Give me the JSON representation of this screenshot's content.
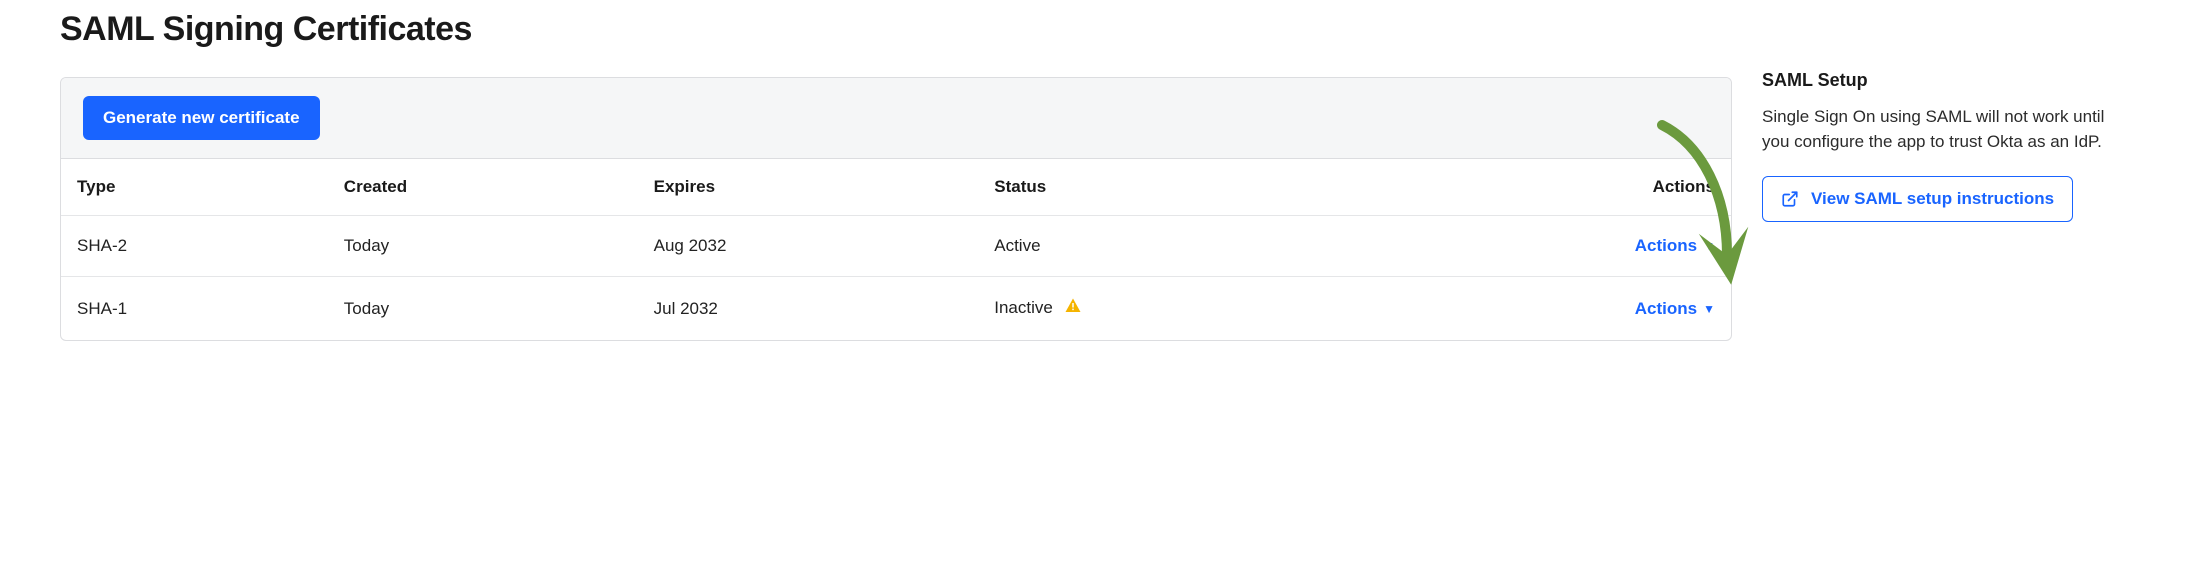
{
  "page_title": "SAML Signing Certificates",
  "generate_button_label": "Generate new certificate",
  "table": {
    "headers": {
      "type": "Type",
      "created": "Created",
      "expires": "Expires",
      "status": "Status",
      "actions": "Actions"
    },
    "rows": [
      {
        "type": "SHA-2",
        "created": "Today",
        "expires": "Aug 2032",
        "status": "Active",
        "warn": false,
        "actions_label": "Actions"
      },
      {
        "type": "SHA-1",
        "created": "Today",
        "expires": "Jul 2032",
        "status": "Inactive",
        "warn": true,
        "actions_label": "Actions"
      }
    ]
  },
  "sidebar": {
    "title": "SAML Setup",
    "description": "Single Sign On using SAML will not work until you configure the app to trust Okta as an IdP.",
    "view_instructions_label": "View SAML setup instructions"
  },
  "icons": {
    "warning": "warning-icon",
    "external": "external-link-icon",
    "caret": "▼"
  },
  "colors": {
    "primary": "#1964ff",
    "warn_bg": "#f5b400",
    "arrow": "#6b9a3e"
  }
}
